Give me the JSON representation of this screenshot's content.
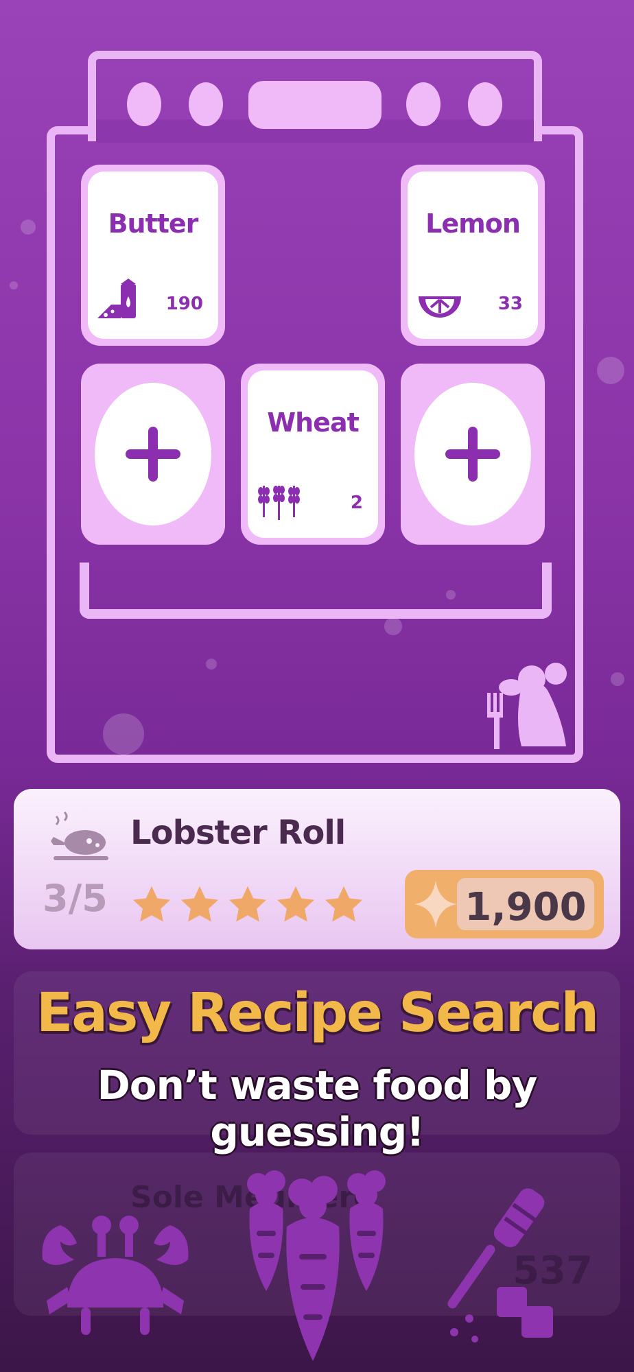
{
  "ingredients": [
    {
      "name": "Butter",
      "count": "190",
      "icon": "butter-milk-icon"
    },
    {
      "name": "Lemon",
      "count": "33",
      "icon": "lemon-slice-icon"
    },
    {
      "name": "Wheat",
      "count": "2",
      "icon": "wheat-icon"
    }
  ],
  "empty_slots": [
    {
      "icon": "plus-icon"
    },
    {
      "icon": "plus-icon"
    }
  ],
  "recipe": {
    "title": "Lobster Roll",
    "progress": "3/5",
    "stars": 5,
    "price": "1,900",
    "icon": "roast-chicken-icon",
    "price_icon": "sparkle-icon"
  },
  "ghost_recipe": {
    "title": "Sole Meunière",
    "price": "537"
  },
  "promo": {
    "headline": "Easy Recipe Search",
    "subline": "Don’t waste food by guessing!"
  },
  "bottom_icons": [
    "crab-icon",
    "carrots-icon",
    "honey-dipper-icon"
  ],
  "colors": {
    "background": "#8d37ad",
    "card_outline": "#f0baf8",
    "text_purple": "#8b2fb0",
    "headline_gold": "#f2b84a",
    "star": "#f0a868"
  }
}
